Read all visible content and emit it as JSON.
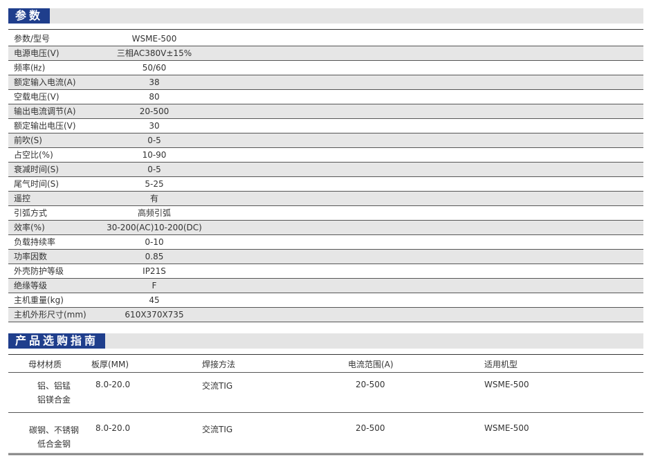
{
  "params_section": {
    "title": "参数",
    "rows": [
      {
        "name": "参数/型号",
        "value": "WSME-500"
      },
      {
        "name": "电源电压(V)",
        "value": "三相AC380V±15%"
      },
      {
        "name": "频率(㎐)",
        "value": "50/60"
      },
      {
        "name": "额定输入电流(A)",
        "value": "38"
      },
      {
        "name": "空载电压(V)",
        "value": "80"
      },
      {
        "name": "输出电流调节(A)",
        "value": "20-500"
      },
      {
        "name": "额定输出电压(V)",
        "value": "30"
      },
      {
        "name": "前吹(S)",
        "value": "0-5"
      },
      {
        "name": "占空比(%)",
        "value": "10-90"
      },
      {
        "name": "衰减时间(S)",
        "value": "0-5"
      },
      {
        "name": "尾气时间(S)",
        "value": "5-25"
      },
      {
        "name": "遥控",
        "value": "有"
      },
      {
        "name": "引弧方式",
        "value": "高频引弧"
      },
      {
        "name": "效率(%)",
        "value": "30-200(AC)10-200(DC)"
      },
      {
        "name": "负载持续率",
        "value": "0-10"
      },
      {
        "name": "功率因数",
        "value": "0.85"
      },
      {
        "name": "外壳防护等级",
        "value": "IP21S"
      },
      {
        "name": "绝缘等级",
        "value": "F"
      },
      {
        "name": "主机重量(kg)",
        "value": "45"
      },
      {
        "name": "主机外形尺寸(mm)",
        "value": "610X370X735"
      }
    ]
  },
  "guide_section": {
    "title": "产品选购指南",
    "headers": {
      "material": "母材材质",
      "thickness": "板厚(MM)",
      "method": "焊接方法",
      "current": "电流范围(A)",
      "model": "适用机型"
    },
    "rows": [
      {
        "material_line1": "铝、铝锰",
        "material_line2": "铝镁合金",
        "thickness": "8.0-20.0",
        "method": "交流TIG",
        "current": "20-500",
        "model": "WSME-500"
      },
      {
        "material_line1": "碳钢、不锈钢",
        "material_line2": "低合金钢",
        "thickness": "8.0-20.0",
        "method": "交流TIG",
        "current": "20-500",
        "model": "WSME-500"
      }
    ]
  },
  "colors": {
    "title_bar": "#1f3e8c",
    "section_band": "#e4e4e4",
    "row_alt": "#e6e6e6"
  }
}
